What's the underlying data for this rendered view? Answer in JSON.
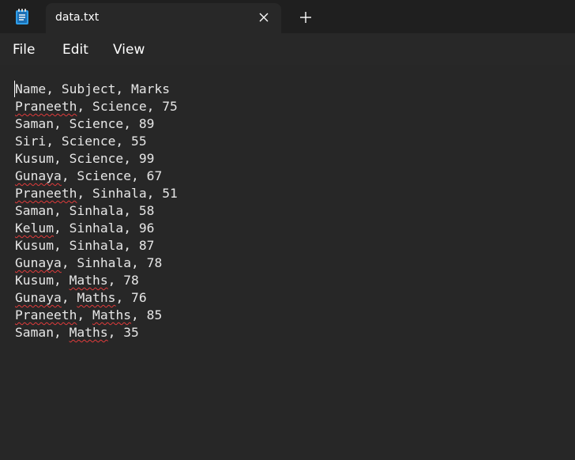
{
  "window": {
    "tab_title": "data.txt",
    "app_icon": "notepad-icon",
    "close_icon": "close-icon",
    "new_tab_icon": "plus-icon"
  },
  "menu": {
    "file": "File",
    "edit": "Edit",
    "view": "View"
  },
  "document": {
    "lines": [
      [
        {
          "t": "Name, Subject, Marks"
        }
      ],
      [
        {
          "t": "Praneeth",
          "sq": true
        },
        {
          "t": ", Science, 75"
        }
      ],
      [
        {
          "t": "Saman, Science, 89"
        }
      ],
      [
        {
          "t": "Siri, Science, 55"
        }
      ],
      [
        {
          "t": "Kusum, Science, 99"
        }
      ],
      [
        {
          "t": "Gunaya",
          "sq": true
        },
        {
          "t": ", Science, 67"
        }
      ],
      [
        {
          "t": "Praneeth",
          "sq": true
        },
        {
          "t": ", Sinhala, 51"
        }
      ],
      [
        {
          "t": "Saman, Sinhala, 58"
        }
      ],
      [
        {
          "t": "Kelum",
          "sq": true
        },
        {
          "t": ", Sinhala, 96"
        }
      ],
      [
        {
          "t": "Kusum, Sinhala, 87"
        }
      ],
      [
        {
          "t": "Gunaya",
          "sq": true
        },
        {
          "t": ", Sinhala, 78"
        }
      ],
      [
        {
          "t": "Kusum, "
        },
        {
          "t": "Maths",
          "sq": true
        },
        {
          "t": ", 78"
        }
      ],
      [
        {
          "t": "Gunaya",
          "sq": true
        },
        {
          "t": ", "
        },
        {
          "t": "Maths",
          "sq": true
        },
        {
          "t": ", 76"
        }
      ],
      [
        {
          "t": "Praneeth",
          "sq": true
        },
        {
          "t": ", "
        },
        {
          "t": "Maths",
          "sq": true
        },
        {
          "t": ", 85"
        }
      ],
      [
        {
          "t": "Saman, "
        },
        {
          "t": "Maths",
          "sq": true
        },
        {
          "t": ", 35"
        }
      ]
    ]
  },
  "colors": {
    "titlebar": "#1f1f1f",
    "background": "#272727",
    "text": "#e6e6e6",
    "spellcheck": "#e03b3b",
    "icon_accent": "#2f9ee8"
  }
}
